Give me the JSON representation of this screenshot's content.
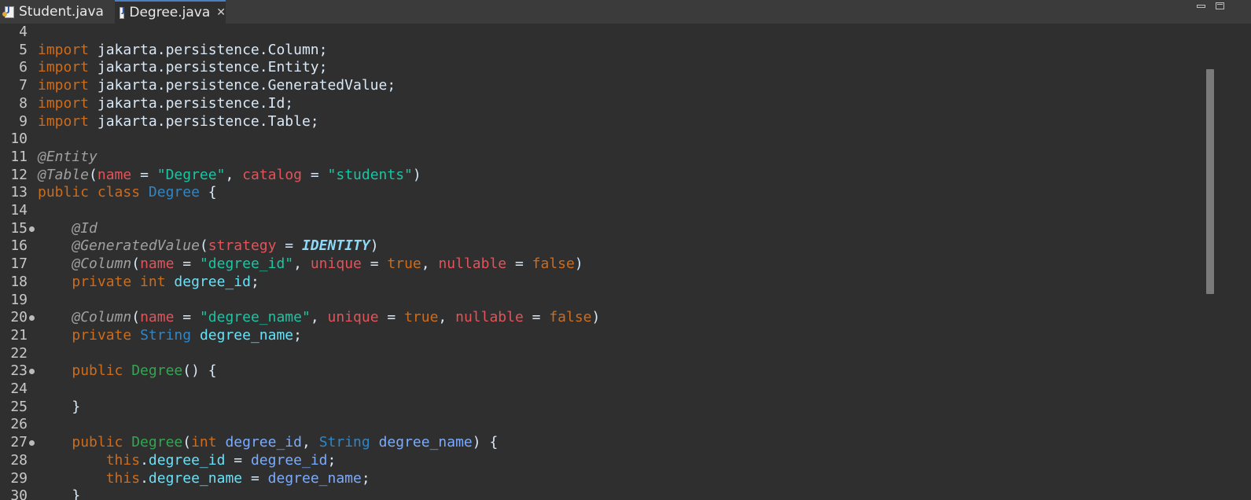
{
  "tabs": [
    {
      "label": "Student.java",
      "active": false
    },
    {
      "label": "Degree.java",
      "active": true
    }
  ],
  "editor": {
    "lines": [
      {
        "n": "4",
        "fold": false,
        "tokens": []
      },
      {
        "n": "5",
        "fold": false,
        "tokens": [
          {
            "t": "import",
            "c": "kw"
          },
          {
            "t": " jakarta.persistence.Column;",
            "c": "plain"
          }
        ]
      },
      {
        "n": "6",
        "fold": false,
        "tokens": [
          {
            "t": "import",
            "c": "kw"
          },
          {
            "t": " jakarta.persistence.Entity;",
            "c": "plain"
          }
        ]
      },
      {
        "n": "7",
        "fold": false,
        "tokens": [
          {
            "t": "import",
            "c": "kw"
          },
          {
            "t": " jakarta.persistence.GeneratedValue;",
            "c": "plain"
          }
        ]
      },
      {
        "n": "8",
        "fold": false,
        "tokens": [
          {
            "t": "import",
            "c": "kw"
          },
          {
            "t": " jakarta.persistence.Id;",
            "c": "plain"
          }
        ]
      },
      {
        "n": "9",
        "fold": false,
        "tokens": [
          {
            "t": "import",
            "c": "kw"
          },
          {
            "t": " jakarta.persistence.Table;",
            "c": "plain"
          }
        ]
      },
      {
        "n": "10",
        "fold": false,
        "tokens": []
      },
      {
        "n": "11",
        "fold": false,
        "tokens": [
          {
            "t": "@Entity",
            "c": "ann"
          }
        ]
      },
      {
        "n": "12",
        "fold": false,
        "tokens": [
          {
            "t": "@Table",
            "c": "ann"
          },
          {
            "t": "(",
            "c": "plain"
          },
          {
            "t": "name",
            "c": "attr"
          },
          {
            "t": " = ",
            "c": "plain"
          },
          {
            "t": "\"Degree\"",
            "c": "str"
          },
          {
            "t": ", ",
            "c": "plain"
          },
          {
            "t": "catalog",
            "c": "attr"
          },
          {
            "t": " = ",
            "c": "plain"
          },
          {
            "t": "\"students\"",
            "c": "str"
          },
          {
            "t": ")",
            "c": "plain"
          }
        ]
      },
      {
        "n": "13",
        "fold": false,
        "tokens": [
          {
            "t": "public class ",
            "c": "kw"
          },
          {
            "t": "Degree",
            "c": "type"
          },
          {
            "t": " {",
            "c": "plain"
          }
        ]
      },
      {
        "n": "14",
        "fold": false,
        "tokens": []
      },
      {
        "n": "15",
        "fold": true,
        "tokens": [
          {
            "t": "    ",
            "c": "plain"
          },
          {
            "t": "@Id",
            "c": "ann"
          }
        ]
      },
      {
        "n": "16",
        "fold": false,
        "tokens": [
          {
            "t": "    ",
            "c": "plain"
          },
          {
            "t": "@GeneratedValue",
            "c": "ann"
          },
          {
            "t": "(",
            "c": "plain"
          },
          {
            "t": "strategy",
            "c": "attr"
          },
          {
            "t": " = ",
            "c": "plain"
          },
          {
            "t": "IDENTITY",
            "c": "enumconst"
          },
          {
            "t": ")",
            "c": "plain"
          }
        ]
      },
      {
        "n": "17",
        "fold": false,
        "tokens": [
          {
            "t": "    ",
            "c": "plain"
          },
          {
            "t": "@Column",
            "c": "ann"
          },
          {
            "t": "(",
            "c": "plain"
          },
          {
            "t": "name",
            "c": "attr"
          },
          {
            "t": " = ",
            "c": "plain"
          },
          {
            "t": "\"degree_id\"",
            "c": "str"
          },
          {
            "t": ", ",
            "c": "plain"
          },
          {
            "t": "unique",
            "c": "attr"
          },
          {
            "t": " = ",
            "c": "plain"
          },
          {
            "t": "true",
            "c": "kw"
          },
          {
            "t": ", ",
            "c": "plain"
          },
          {
            "t": "nullable",
            "c": "attr"
          },
          {
            "t": " = ",
            "c": "plain"
          },
          {
            "t": "false",
            "c": "kw"
          },
          {
            "t": ")",
            "c": "plain"
          }
        ]
      },
      {
        "n": "18",
        "fold": false,
        "tokens": [
          {
            "t": "    ",
            "c": "plain"
          },
          {
            "t": "private int ",
            "c": "kw"
          },
          {
            "t": "degree_id",
            "c": "field"
          },
          {
            "t": ";",
            "c": "plain"
          }
        ]
      },
      {
        "n": "19",
        "fold": false,
        "tokens": []
      },
      {
        "n": "20",
        "fold": true,
        "tokens": [
          {
            "t": "    ",
            "c": "plain"
          },
          {
            "t": "@Column",
            "c": "ann"
          },
          {
            "t": "(",
            "c": "plain"
          },
          {
            "t": "name",
            "c": "attr"
          },
          {
            "t": " = ",
            "c": "plain"
          },
          {
            "t": "\"degree_name\"",
            "c": "str"
          },
          {
            "t": ", ",
            "c": "plain"
          },
          {
            "t": "unique",
            "c": "attr"
          },
          {
            "t": " = ",
            "c": "plain"
          },
          {
            "t": "true",
            "c": "kw"
          },
          {
            "t": ", ",
            "c": "plain"
          },
          {
            "t": "nullable",
            "c": "attr"
          },
          {
            "t": " = ",
            "c": "plain"
          },
          {
            "t": "false",
            "c": "kw"
          },
          {
            "t": ")",
            "c": "plain"
          }
        ]
      },
      {
        "n": "21",
        "fold": false,
        "tokens": [
          {
            "t": "    ",
            "c": "plain"
          },
          {
            "t": "private ",
            "c": "kw"
          },
          {
            "t": "String",
            "c": "type"
          },
          {
            "t": " ",
            "c": "plain"
          },
          {
            "t": "degree_name",
            "c": "field"
          },
          {
            "t": ";",
            "c": "plain"
          }
        ]
      },
      {
        "n": "22",
        "fold": false,
        "tokens": []
      },
      {
        "n": "23",
        "fold": true,
        "tokens": [
          {
            "t": "    ",
            "c": "plain"
          },
          {
            "t": "public ",
            "c": "kw"
          },
          {
            "t": "Degree",
            "c": "ctor"
          },
          {
            "t": "() {",
            "c": "plain"
          }
        ]
      },
      {
        "n": "24",
        "fold": false,
        "tokens": []
      },
      {
        "n": "25",
        "fold": false,
        "tokens": [
          {
            "t": "    }",
            "c": "plain"
          }
        ]
      },
      {
        "n": "26",
        "fold": false,
        "tokens": []
      },
      {
        "n": "27",
        "fold": true,
        "tokens": [
          {
            "t": "    ",
            "c": "plain"
          },
          {
            "t": "public ",
            "c": "kw"
          },
          {
            "t": "Degree",
            "c": "ctor"
          },
          {
            "t": "(",
            "c": "plain"
          },
          {
            "t": "int ",
            "c": "kw"
          },
          {
            "t": "degree_id",
            "c": "param"
          },
          {
            "t": ", ",
            "c": "plain"
          },
          {
            "t": "String",
            "c": "type"
          },
          {
            "t": " ",
            "c": "plain"
          },
          {
            "t": "degree_name",
            "c": "param"
          },
          {
            "t": ") {",
            "c": "plain"
          }
        ]
      },
      {
        "n": "28",
        "fold": false,
        "tokens": [
          {
            "t": "        ",
            "c": "plain"
          },
          {
            "t": "this",
            "c": "kw"
          },
          {
            "t": ".",
            "c": "plain"
          },
          {
            "t": "degree_id",
            "c": "field"
          },
          {
            "t": " = ",
            "c": "plain"
          },
          {
            "t": "degree_id",
            "c": "param"
          },
          {
            "t": ";",
            "c": "plain"
          }
        ]
      },
      {
        "n": "29",
        "fold": false,
        "tokens": [
          {
            "t": "        ",
            "c": "plain"
          },
          {
            "t": "this",
            "c": "kw"
          },
          {
            "t": ".",
            "c": "plain"
          },
          {
            "t": "degree_name",
            "c": "field"
          },
          {
            "t": " = ",
            "c": "plain"
          },
          {
            "t": "degree_name",
            "c": "param"
          },
          {
            "t": ";",
            "c": "plain"
          }
        ]
      },
      {
        "n": "30",
        "fold": false,
        "tokens": [
          {
            "t": "    }",
            "c": "plain"
          }
        ]
      }
    ]
  }
}
